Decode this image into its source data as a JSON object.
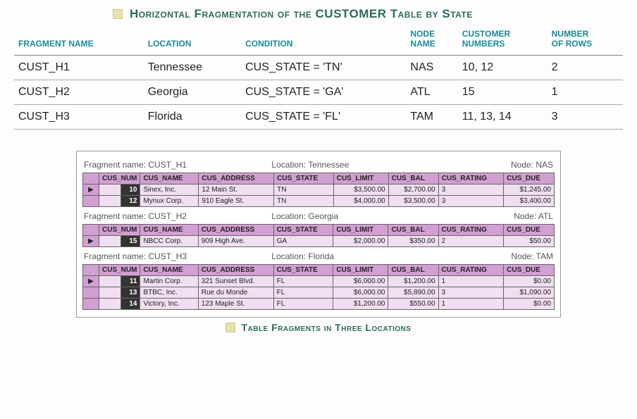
{
  "title": "Horizontal Fragmentation of the CUSTOMER Table by State",
  "summary": {
    "headers": {
      "fragment_name": "FRAGMENT NAME",
      "location": "LOCATION",
      "condition": "CONDITION",
      "node_name": "NODE NAME",
      "customer_numbers": "CUSTOMER NUMBERS",
      "number_of_rows": "NUMBER OF ROWS"
    },
    "rows": [
      {
        "fragment_name": "CUST_H1",
        "location": "Tennessee",
        "condition": "CUS_STATE = 'TN'",
        "node_name": "NAS",
        "customer_numbers": "10, 12",
        "number_of_rows": "2"
      },
      {
        "fragment_name": "CUST_H2",
        "location": "Georgia",
        "condition": "CUS_STATE = 'GA'",
        "node_name": "ATL",
        "customer_numbers": "15",
        "number_of_rows": "1"
      },
      {
        "fragment_name": "CUST_H3",
        "location": "Florida",
        "condition": "CUS_STATE = 'FL'",
        "node_name": "TAM",
        "customer_numbers": "11, 13, 14",
        "number_of_rows": "3"
      }
    ]
  },
  "labels": {
    "fragment_name": "Fragment name:",
    "location": "Location:",
    "node": "Node:"
  },
  "data_headers": {
    "cus_num": "CUS_NUM",
    "cus_name": "CUS_NAME",
    "cus_address": "CUS_ADDRESS",
    "cus_state": "CUS_STATE",
    "cus_limit": "CUS_LIMIT",
    "cus_bal": "CUS_BAL",
    "cus_rating": "CUS_RATING",
    "cus_due": "CUS_DUE"
  },
  "fragments": [
    {
      "name": "CUST_H1",
      "location": "Tennessee",
      "node": "NAS",
      "rows": [
        {
          "sel": "▶",
          "num": "10",
          "name": "Sinex, Inc.",
          "addr": "12 Main St.",
          "state": "TN",
          "limit": "$3,500.00",
          "bal": "$2,700.00",
          "rating": "3",
          "due": "$1,245.00"
        },
        {
          "sel": "",
          "num": "12",
          "name": "Mynux Corp.",
          "addr": "910 Eagle St.",
          "state": "TN",
          "limit": "$4,000.00",
          "bal": "$3,500.00",
          "rating": "3",
          "due": "$3,400.00"
        }
      ]
    },
    {
      "name": "CUST_H2",
      "location": "Georgia",
      "node": "ATL",
      "rows": [
        {
          "sel": "▶",
          "num": "15",
          "name": "NBCC Corp.",
          "addr": "909 High Ave.",
          "state": "GA",
          "limit": "$2,000.00",
          "bal": "$350.00",
          "rating": "2",
          "due": "$50.00"
        }
      ]
    },
    {
      "name": "CUST_H3",
      "location": "Florida",
      "node": "TAM",
      "rows": [
        {
          "sel": "▶",
          "num": "11",
          "name": "Martin Corp.",
          "addr": "321 Sunset Blvd.",
          "state": "FL",
          "limit": "$6,000.00",
          "bal": "$1,200.00",
          "rating": "1",
          "due": "$0.00"
        },
        {
          "sel": "",
          "num": "13",
          "name": "BTBC, Inc.",
          "addr": "Rue du Monde",
          "state": "FL",
          "limit": "$6,000.00",
          "bal": "$5,890.00",
          "rating": "3",
          "due": "$1,090.00"
        },
        {
          "sel": "",
          "num": "14",
          "name": "Victory, Inc.",
          "addr": "123 Maple St.",
          "state": "FL",
          "limit": "$1,200.00",
          "bal": "$550.00",
          "rating": "1",
          "due": "$0.00"
        }
      ]
    }
  ],
  "caption": "Table Fragments in Three Locations"
}
